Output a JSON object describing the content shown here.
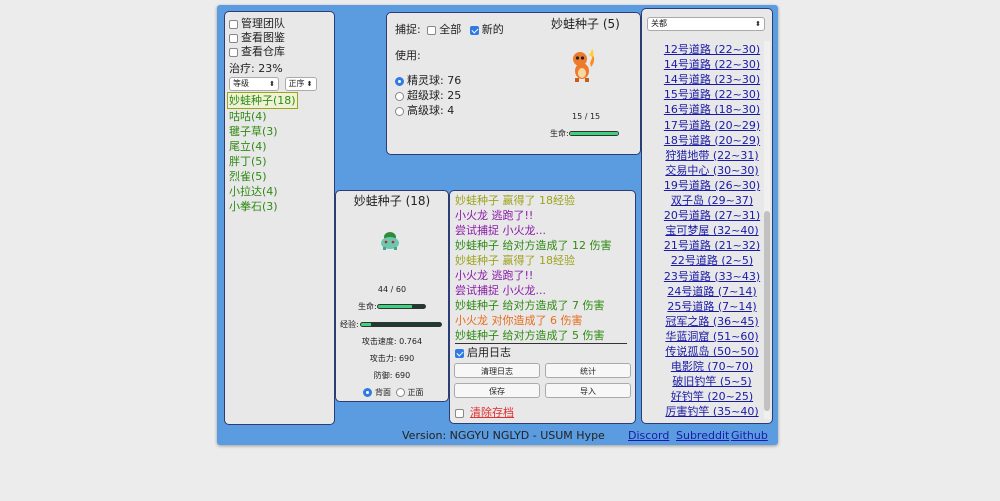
{
  "left_panel": {
    "options": [
      {
        "label": "管理团队",
        "checked": false
      },
      {
        "label": "查看图鉴",
        "checked": false
      },
      {
        "label": "查看仓库",
        "checked": false
      }
    ],
    "heal_label": "治疗: 23%",
    "sort_field": "等级",
    "sort_order": "正序",
    "party": [
      {
        "label": "妙蛙种子(18)",
        "selected": true
      },
      {
        "label": "咕咕(4)"
      },
      {
        "label": "毽子草(3)"
      },
      {
        "label": "尾立(4)"
      },
      {
        "label": "胖丁(5)"
      },
      {
        "label": "烈雀(5)"
      },
      {
        "label": "小拉达(4)"
      },
      {
        "label": "小拳石(3)"
      }
    ]
  },
  "wild_panel": {
    "catch_label": "捕捉:",
    "catch_all": "全部",
    "catch_new": "新的",
    "use_label": "使用:",
    "balls": [
      {
        "label": "精灵球: 76",
        "selected": true
      },
      {
        "label": "超级球: 25",
        "selected": false
      },
      {
        "label": "高级球: 4",
        "selected": false
      }
    ],
    "name": "妙蛙种子 (5)",
    "hp_text": "15 / 15",
    "hp_label": "生命:",
    "hp_fraction": 1.0,
    "icon": "charmander-sprite"
  },
  "player_panel": {
    "name": "妙蛙种子 (18)",
    "icon": "bulbasaur-sprite",
    "hp_text": "44 / 60",
    "hp_label": "生命:",
    "hp_fraction": 0.73,
    "exp_label": "经验:",
    "exp_fraction": 0.12,
    "speed": "攻击速度: 0.764",
    "attack": "攻击力: 690",
    "defense": "防御: 690",
    "view_back": "背面",
    "view_front": "正面"
  },
  "log_panel": {
    "entries": [
      {
        "text": "妙蛙种子 赢得了 18经验",
        "color": "olive"
      },
      {
        "text": "小火龙 逃跑了!!",
        "color": "purple"
      },
      {
        "text": "尝试捕捉 小火龙...",
        "color": "purple"
      },
      {
        "text": "妙蛙种子 给对方造成了 12 伤害",
        "color": "green"
      },
      {
        "text": "妙蛙种子 赢得了 18经验",
        "color": "olive"
      },
      {
        "text": "小火龙 逃跑了!!",
        "color": "purple"
      },
      {
        "text": "尝试捕捉 小火龙...",
        "color": "purple"
      },
      {
        "text": "妙蛙种子 给对方造成了 7 伤害",
        "color": "green"
      },
      {
        "text": "小火龙 对你造成了 6 伤害",
        "color": "orange"
      },
      {
        "text": "妙蛙种子 给对方造成了 5 伤害",
        "color": "green"
      }
    ],
    "enable_log": "启用日志",
    "clear_log": "清理日志",
    "stats": "统计",
    "save": "保存",
    "import": "导入",
    "clear_save": "清除存档"
  },
  "routes_panel": {
    "region": "关都",
    "routes": [
      "12号道路 (22~30)",
      "14号道路 (22~30)",
      "14号道路 (23~30)",
      "15号道路 (22~30)",
      "16号道路 (18~30)",
      "17号道路 (20~29)",
      "18号道路 (20~29)",
      "狩猎地带 (22~31)",
      "交易中心 (30~30)",
      "19号道路 (26~30)",
      "双子岛 (29~37)",
      "20号道路 (27~31)",
      "宝可梦屋 (32~40)",
      "21号道路 (21~32)",
      "22号道路 (2~5)",
      "23号道路 (33~43)",
      "24号道路 (7~14)",
      "25号道路 (7~14)",
      "冠军之路 (36~45)",
      "华蓝洞窟 (51~60)",
      "传说孤岛 (50~50)",
      "电影院 (70~70)",
      "破旧钓竿 (5~5)",
      "好钓竿 (20~25)",
      "厉害钓竿 (35~40)"
    ]
  },
  "footer": {
    "version": "Version: NGGYU NGLYD - USUM Hype",
    "discord": "Discord",
    "subreddit": "Subreddit",
    "github": "Github"
  }
}
